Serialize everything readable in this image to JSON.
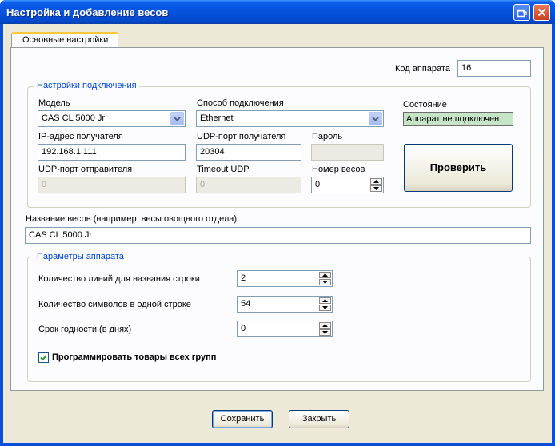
{
  "window": {
    "title": "Настройка и добавление весов"
  },
  "tabs": [
    {
      "label": "Основные настройки",
      "active": true
    }
  ],
  "device_code": {
    "label": "Код аппарата",
    "value": "16"
  },
  "connection": {
    "group_title": "Настройки подключения",
    "model": {
      "label": "Модель",
      "value": "CAS CL 5000 Jr"
    },
    "method": {
      "label": "Способ подключения",
      "value": "Ethernet"
    },
    "ip": {
      "label": "IP-адрес получателя",
      "value": "192.168.1.111"
    },
    "udp_recv": {
      "label": "UDP-порт получателя",
      "value": "20304"
    },
    "password": {
      "label": "Пароль",
      "value": ""
    },
    "udp_send": {
      "label": "UDP-порт отправителя",
      "value": "0"
    },
    "timeout": {
      "label": "Timeout UDP",
      "value": "0"
    },
    "scale_number": {
      "label": "Номер весов",
      "value": "0"
    },
    "state": {
      "label": "Состояние",
      "value": "Аппарат не подключен",
      "color": "#c6e4c6"
    },
    "check_button": "Проверить"
  },
  "scale_name": {
    "label": "Название весов (например, весы овощного отдела)",
    "value": "CAS CL 5000 Jr"
  },
  "device_params": {
    "group_title": "Параметры аппарата",
    "lines_count": {
      "label": "Количество линий для названия строки",
      "value": "2"
    },
    "chars_count": {
      "label": "Количество символов в одной строке",
      "value": "54"
    },
    "shelf_life": {
      "label": "Срок годности (в днях)",
      "value": "0"
    },
    "program_all": {
      "label": "Программировать товары всех групп",
      "checked": true
    }
  },
  "footer": {
    "save_label": "Сохранить",
    "close_label": "Закрыть"
  }
}
